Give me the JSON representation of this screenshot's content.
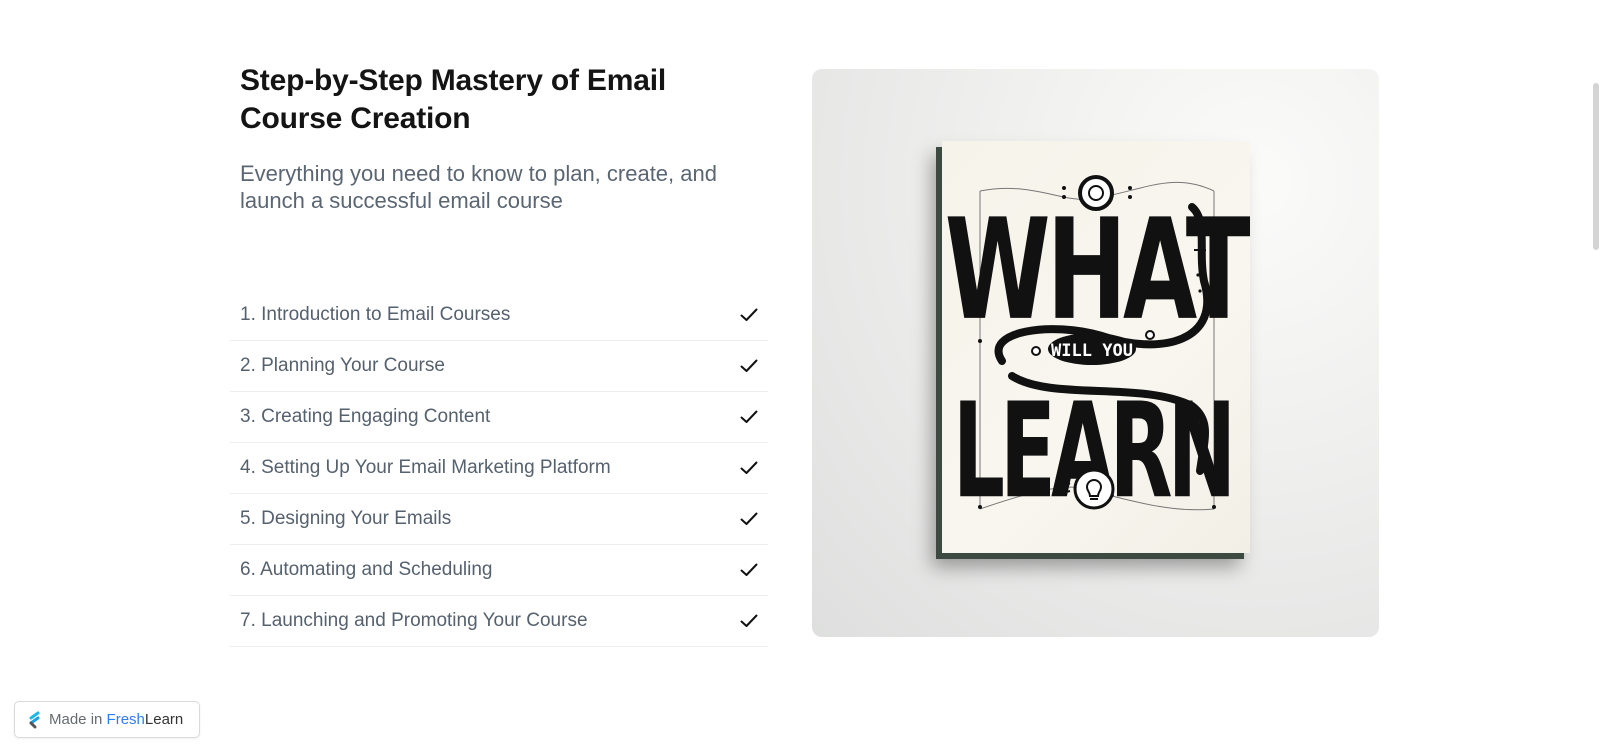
{
  "course": {
    "title": "Step-by-Step Mastery of Email Course Creation",
    "subtitle": "Everything you need to know to plan, create, and launch a successful email course"
  },
  "lessons": [
    {
      "label": "1. Introduction to Email Courses",
      "icon": "check-icon"
    },
    {
      "label": "2. Planning Your Course",
      "icon": "check-icon"
    },
    {
      "label": "3. Creating Engaging Content",
      "icon": "check-icon"
    },
    {
      "label": "4. Setting Up Your Email Marketing Platform",
      "icon": "check-icon"
    },
    {
      "label": "5. Designing Your Emails",
      "icon": "check-icon"
    },
    {
      "label": "6. Automating and Scheduling",
      "icon": "check-icon"
    },
    {
      "label": "7. Launching and Promoting Your Course",
      "icon": "check-icon"
    }
  ],
  "hero_image": {
    "alt": "What will you learn poster",
    "text_top": "WHAT",
    "text_middle": "WILL YOU",
    "text_bottom": "LEARN",
    "icon": "lightbulb-icon"
  },
  "badge": {
    "prefix": "Made in ",
    "brand_fresh": "Fresh",
    "brand_learn": "Learn",
    "icon": "freshlearn-logo-icon"
  },
  "colors": {
    "title": "#141414",
    "subtitle": "#5b6673",
    "lesson_text": "#56616e",
    "brand_blue": "#2f7df6",
    "divider": "#eceef0"
  }
}
